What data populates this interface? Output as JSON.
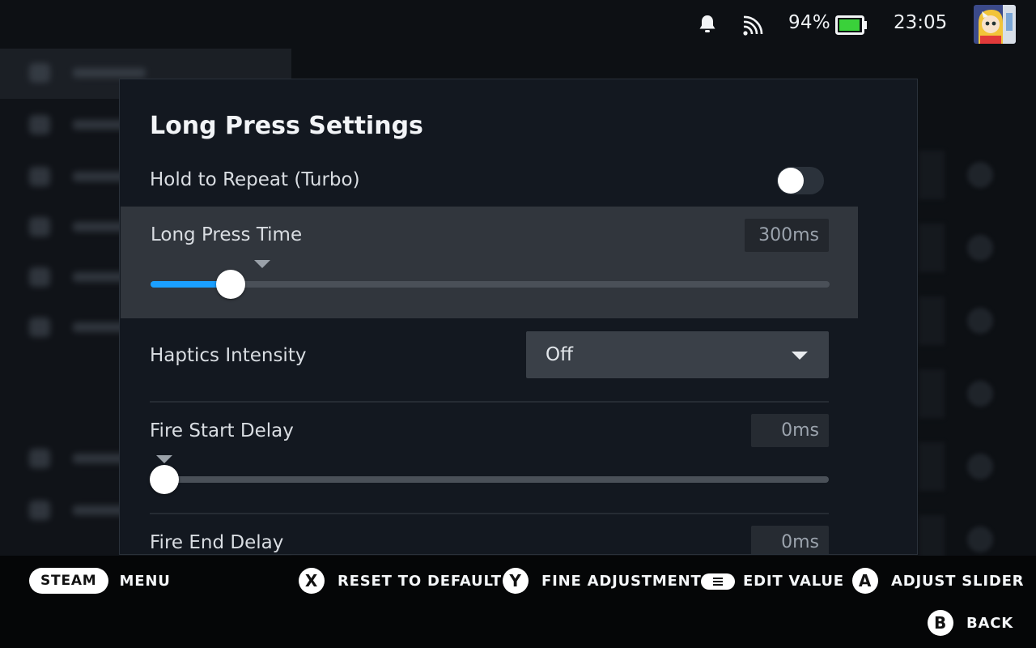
{
  "status": {
    "battery_percent": "94%",
    "battery_level": 0.94,
    "time": "23:05"
  },
  "dialog": {
    "title": "Long Press Settings",
    "hold_to_repeat": {
      "label": "Hold to Repeat (Turbo)",
      "enabled": false
    },
    "long_press_time": {
      "label": "Long Press Time",
      "value": "300ms",
      "slider_fraction": 0.118,
      "default_fraction": 0.165
    },
    "haptics_intensity": {
      "label": "Haptics Intensity",
      "value": "Off"
    },
    "fire_start_delay": {
      "label": "Fire Start Delay",
      "value": "0ms",
      "slider_fraction": 0.0,
      "default_fraction": 0.0
    },
    "fire_end_delay": {
      "label": "Fire End Delay",
      "value": "0ms"
    }
  },
  "legend": {
    "steam": "STEAM",
    "menu": "MENU",
    "x_key": "X",
    "reset": "RESET TO DEFAULT",
    "y_key": "Y",
    "fine": "FINE ADJUSTMENT",
    "edit": "EDIT VALUE",
    "a_key": "A",
    "adjust": "ADJUST SLIDER",
    "b_key": "B",
    "back": "BACK"
  },
  "colors": {
    "accent": "#1a9fff",
    "battery": "#3ad13a"
  }
}
